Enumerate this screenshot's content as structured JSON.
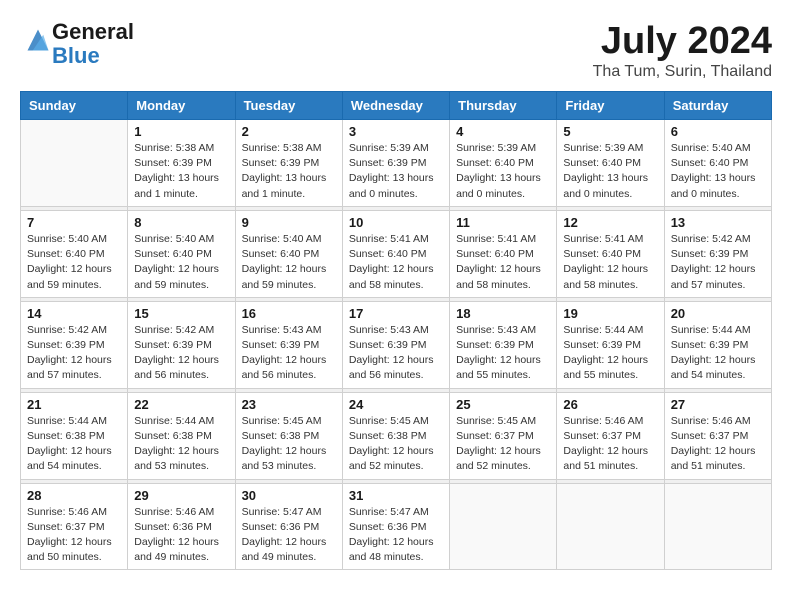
{
  "header": {
    "logo_line1": "General",
    "logo_line2": "Blue",
    "month": "July 2024",
    "location": "Tha Tum, Surin, Thailand"
  },
  "weekdays": [
    "Sunday",
    "Monday",
    "Tuesday",
    "Wednesday",
    "Thursday",
    "Friday",
    "Saturday"
  ],
  "weeks": [
    [
      {
        "day": "",
        "info": ""
      },
      {
        "day": "1",
        "info": "Sunrise: 5:38 AM\nSunset: 6:39 PM\nDaylight: 13 hours\nand 1 minute."
      },
      {
        "day": "2",
        "info": "Sunrise: 5:38 AM\nSunset: 6:39 PM\nDaylight: 13 hours\nand 1 minute."
      },
      {
        "day": "3",
        "info": "Sunrise: 5:39 AM\nSunset: 6:39 PM\nDaylight: 13 hours\nand 0 minutes."
      },
      {
        "day": "4",
        "info": "Sunrise: 5:39 AM\nSunset: 6:40 PM\nDaylight: 13 hours\nand 0 minutes."
      },
      {
        "day": "5",
        "info": "Sunrise: 5:39 AM\nSunset: 6:40 PM\nDaylight: 13 hours\nand 0 minutes."
      },
      {
        "day": "6",
        "info": "Sunrise: 5:40 AM\nSunset: 6:40 PM\nDaylight: 13 hours\nand 0 minutes."
      }
    ],
    [
      {
        "day": "7",
        "info": "Sunrise: 5:40 AM\nSunset: 6:40 PM\nDaylight: 12 hours\nand 59 minutes."
      },
      {
        "day": "8",
        "info": "Sunrise: 5:40 AM\nSunset: 6:40 PM\nDaylight: 12 hours\nand 59 minutes."
      },
      {
        "day": "9",
        "info": "Sunrise: 5:40 AM\nSunset: 6:40 PM\nDaylight: 12 hours\nand 59 minutes."
      },
      {
        "day": "10",
        "info": "Sunrise: 5:41 AM\nSunset: 6:40 PM\nDaylight: 12 hours\nand 58 minutes."
      },
      {
        "day": "11",
        "info": "Sunrise: 5:41 AM\nSunset: 6:40 PM\nDaylight: 12 hours\nand 58 minutes."
      },
      {
        "day": "12",
        "info": "Sunrise: 5:41 AM\nSunset: 6:40 PM\nDaylight: 12 hours\nand 58 minutes."
      },
      {
        "day": "13",
        "info": "Sunrise: 5:42 AM\nSunset: 6:39 PM\nDaylight: 12 hours\nand 57 minutes."
      }
    ],
    [
      {
        "day": "14",
        "info": "Sunrise: 5:42 AM\nSunset: 6:39 PM\nDaylight: 12 hours\nand 57 minutes."
      },
      {
        "day": "15",
        "info": "Sunrise: 5:42 AM\nSunset: 6:39 PM\nDaylight: 12 hours\nand 56 minutes."
      },
      {
        "day": "16",
        "info": "Sunrise: 5:43 AM\nSunset: 6:39 PM\nDaylight: 12 hours\nand 56 minutes."
      },
      {
        "day": "17",
        "info": "Sunrise: 5:43 AM\nSunset: 6:39 PM\nDaylight: 12 hours\nand 56 minutes."
      },
      {
        "day": "18",
        "info": "Sunrise: 5:43 AM\nSunset: 6:39 PM\nDaylight: 12 hours\nand 55 minutes."
      },
      {
        "day": "19",
        "info": "Sunrise: 5:44 AM\nSunset: 6:39 PM\nDaylight: 12 hours\nand 55 minutes."
      },
      {
        "day": "20",
        "info": "Sunrise: 5:44 AM\nSunset: 6:39 PM\nDaylight: 12 hours\nand 54 minutes."
      }
    ],
    [
      {
        "day": "21",
        "info": "Sunrise: 5:44 AM\nSunset: 6:38 PM\nDaylight: 12 hours\nand 54 minutes."
      },
      {
        "day": "22",
        "info": "Sunrise: 5:44 AM\nSunset: 6:38 PM\nDaylight: 12 hours\nand 53 minutes."
      },
      {
        "day": "23",
        "info": "Sunrise: 5:45 AM\nSunset: 6:38 PM\nDaylight: 12 hours\nand 53 minutes."
      },
      {
        "day": "24",
        "info": "Sunrise: 5:45 AM\nSunset: 6:38 PM\nDaylight: 12 hours\nand 52 minutes."
      },
      {
        "day": "25",
        "info": "Sunrise: 5:45 AM\nSunset: 6:37 PM\nDaylight: 12 hours\nand 52 minutes."
      },
      {
        "day": "26",
        "info": "Sunrise: 5:46 AM\nSunset: 6:37 PM\nDaylight: 12 hours\nand 51 minutes."
      },
      {
        "day": "27",
        "info": "Sunrise: 5:46 AM\nSunset: 6:37 PM\nDaylight: 12 hours\nand 51 minutes."
      }
    ],
    [
      {
        "day": "28",
        "info": "Sunrise: 5:46 AM\nSunset: 6:37 PM\nDaylight: 12 hours\nand 50 minutes."
      },
      {
        "day": "29",
        "info": "Sunrise: 5:46 AM\nSunset: 6:36 PM\nDaylight: 12 hours\nand 49 minutes."
      },
      {
        "day": "30",
        "info": "Sunrise: 5:47 AM\nSunset: 6:36 PM\nDaylight: 12 hours\nand 49 minutes."
      },
      {
        "day": "31",
        "info": "Sunrise: 5:47 AM\nSunset: 6:36 PM\nDaylight: 12 hours\nand 48 minutes."
      },
      {
        "day": "",
        "info": ""
      },
      {
        "day": "",
        "info": ""
      },
      {
        "day": "",
        "info": ""
      }
    ]
  ]
}
